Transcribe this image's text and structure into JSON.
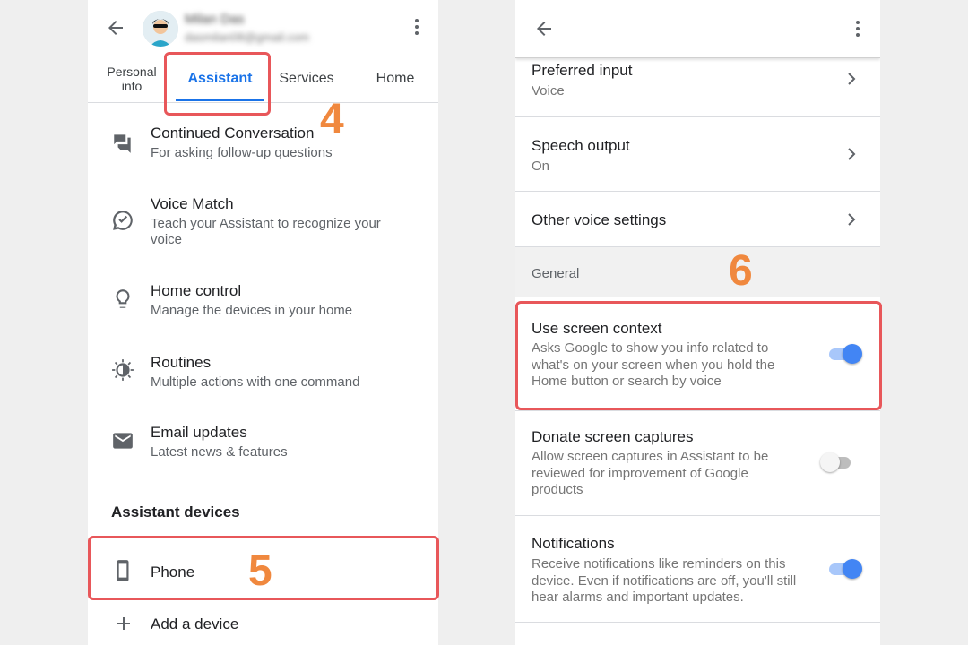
{
  "left": {
    "account": {
      "name": "Milan Das",
      "email": "dasmilan08@gmail.com"
    },
    "tabs": [
      {
        "label": "Personal\ninfo"
      },
      {
        "label": "Assistant"
      },
      {
        "label": "Services"
      },
      {
        "label": "Home"
      }
    ],
    "items": [
      {
        "title": "Continued Conversation",
        "subtitle": "For asking follow-up questions",
        "icon": "chat-icon"
      },
      {
        "title": "Voice Match",
        "subtitle": "Teach your Assistant to recognize your voice",
        "icon": "voice-match-icon"
      },
      {
        "title": "Home control",
        "subtitle": "Manage the devices in your home",
        "icon": "lightbulb-icon"
      },
      {
        "title": "Routines",
        "subtitle": "Multiple actions with one command",
        "icon": "routines-icon"
      },
      {
        "title": "Email updates",
        "subtitle": "Latest news & features",
        "icon": "mail-icon"
      }
    ],
    "devices_section": "Assistant devices",
    "phone_label": "Phone",
    "add_device_label": "Add a device"
  },
  "right": {
    "items": [
      {
        "title": "Preferred input",
        "subtitle": "Voice"
      },
      {
        "title": "Speech output",
        "subtitle": "On"
      },
      {
        "title": "Other voice settings"
      }
    ],
    "section": "General",
    "toggles": [
      {
        "title": "Use screen context",
        "subtitle": "Asks Google to show you info related to what's on your screen when you hold the Home button or search by voice",
        "on": true
      },
      {
        "title": "Donate screen captures",
        "subtitle": "Allow screen captures in Assistant to be reviewed for improvement of Google products",
        "on": false
      },
      {
        "title": "Notifications",
        "subtitle": "Receive notifications like reminders on this device. Even if notifications are off, you'll still hear alarms and important updates.",
        "on": true
      }
    ]
  },
  "steps": {
    "s4": "4",
    "s5": "5",
    "s6": "6"
  },
  "colors": {
    "accent": "#1a73e8",
    "highlight": "#e8575a",
    "step": "#f0883e",
    "toggle_on": "#4285f4"
  }
}
